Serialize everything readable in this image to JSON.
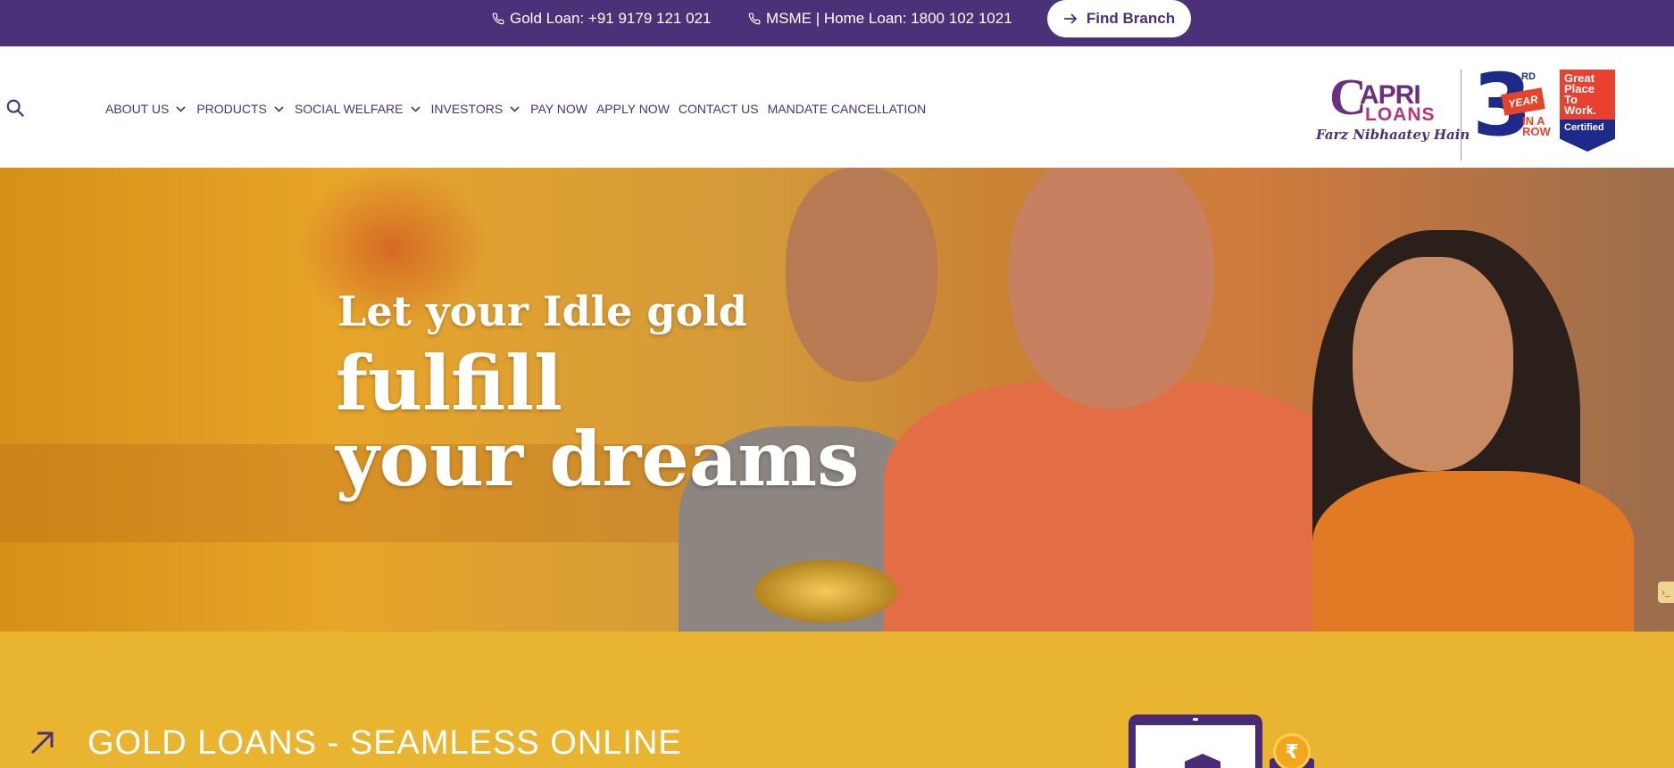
{
  "topbar": {
    "gold_loan": "Gold Loan: +91 9179 121 021",
    "home_loan": "MSME | Home Loan: 1800 102 1021",
    "find_branch": "Find Branch"
  },
  "nav": {
    "items": [
      {
        "label": "ABOUT US",
        "has_dropdown": true
      },
      {
        "label": "PRODUCTS",
        "has_dropdown": true
      },
      {
        "label": "SOCIAL WELFARE",
        "has_dropdown": true
      },
      {
        "label": "INVESTORS",
        "has_dropdown": true
      },
      {
        "label": "PAY NOW",
        "has_dropdown": false
      },
      {
        "label": "APPLY NOW",
        "has_dropdown": false
      },
      {
        "label": "CONTACT US",
        "has_dropdown": false
      },
      {
        "label": "MANDATE CANCELLATION",
        "has_dropdown": false
      }
    ]
  },
  "logo": {
    "c": "C",
    "pri": "APRI",
    "loans": "LOANS",
    "tagline": "Farz Nibhaatey Hain",
    "award_number": "3",
    "award_suffix": "RD",
    "award_year": "YEAR",
    "award_in_a_row": "IN A ROW",
    "gptw_line1": "Great",
    "gptw_line2": "Place",
    "gptw_line3": "To",
    "gptw_line4": "Work.",
    "gptw_certified": "Certified"
  },
  "hero": {
    "line1": "Let your Idle gold",
    "line2": "fulfill",
    "line3": "your dreams"
  },
  "side_tab": "›_",
  "section": {
    "title": "GOLD LOANS - SEAMLESS ONLINE",
    "coin_symbol": "₹"
  },
  "colors": {
    "brand_purple": "#4b3178",
    "hero_gold": "#e9b42f",
    "award_red": "#e8412f",
    "award_blue": "#1e2a8a"
  }
}
